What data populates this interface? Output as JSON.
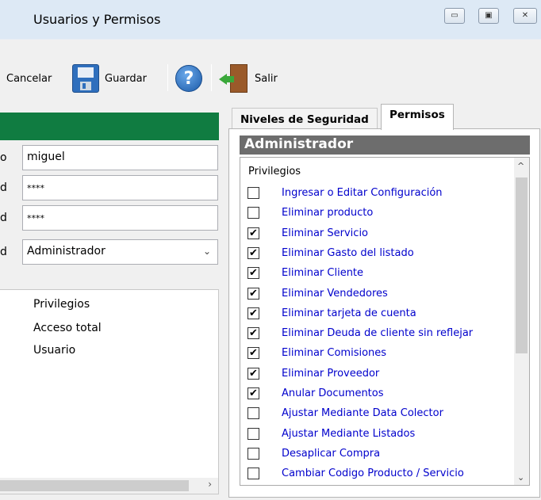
{
  "window": {
    "title": "Usuarios y Permisos",
    "minimize_glyph": "▭",
    "maximize_glyph": "▣",
    "close_glyph": "✕"
  },
  "toolbar": {
    "cancel_label": "Cancelar",
    "save_label": "Guardar",
    "help_glyph": "?",
    "exit_label": "Salir"
  },
  "form": {
    "fields": [
      {
        "label": "o",
        "value": "miguel"
      },
      {
        "label": "d",
        "value": "****"
      },
      {
        "label": "d",
        "value": "****"
      },
      {
        "label": "d",
        "value": "Administrador"
      }
    ],
    "combo_arrow": "⌄"
  },
  "left_list": {
    "header": "Privilegios",
    "items": [
      "Acceso total",
      "Usuario"
    ],
    "scroll_right": "›"
  },
  "tabs": [
    {
      "label": "Niveles de Seguridad",
      "active": false
    },
    {
      "label": "Permisos",
      "active": true
    }
  ],
  "permissions": {
    "title": "Administrador",
    "list_header": "Privilegios",
    "scroll_up": "^",
    "scroll_down": "⌄",
    "items": [
      {
        "label": "Ingresar o Editar Configuración",
        "checked": false
      },
      {
        "label": "Eliminar producto",
        "checked": false
      },
      {
        "label": "Eliminar Servicio",
        "checked": true
      },
      {
        "label": "Eliminar Gasto del listado",
        "checked": true
      },
      {
        "label": "Eliminar Cliente",
        "checked": true
      },
      {
        "label": "Eliminar Vendedores",
        "checked": true
      },
      {
        "label": "Eliminar tarjeta de cuenta",
        "checked": true
      },
      {
        "label": "Eliminar Deuda de cliente sin reflejar",
        "checked": true
      },
      {
        "label": "Eliminar Comisiones",
        "checked": true
      },
      {
        "label": "Eliminar Proveedor",
        "checked": true
      },
      {
        "label": "Anular Documentos",
        "checked": true
      },
      {
        "label": "Ajustar Mediante Data Colector",
        "checked": false
      },
      {
        "label": "Ajustar Mediante Listados",
        "checked": false
      },
      {
        "label": "Desaplicar Compra",
        "checked": false
      },
      {
        "label": "Cambiar Codigo Producto / Servicio",
        "checked": false
      }
    ]
  },
  "colors": {
    "accent_green": "#107c41",
    "panel_header": "#6d6d6d",
    "link_blue": "#0000cc"
  }
}
